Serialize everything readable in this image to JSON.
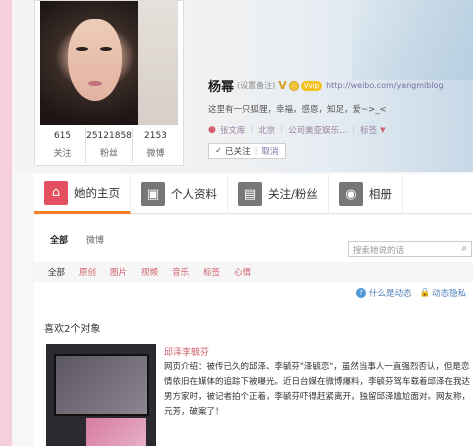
{
  "profile": {
    "stats": [
      {
        "num": "615",
        "label": "关注"
      },
      {
        "num": "25121858",
        "label": "粉丝"
      },
      {
        "num": "2153",
        "label": "微博"
      }
    ],
    "name": "杨幂",
    "note": "(设置备注)",
    "vip_badge": "V",
    "pill": "Vvip",
    "url": "http://weibo.com/yangmiblog",
    "intro": "这里有一只狐狸，幸福，感恩，知足，爱~>_<",
    "meta": {
      "gender_icon": "person-icon",
      "company": "张文库",
      "location": "北京",
      "org": "公司美亚娱乐...",
      "tag": "标签"
    },
    "follow": {
      "check": "✓",
      "followed": "已关注",
      "cancel": "取消"
    }
  },
  "tabs": [
    {
      "label": "她的主页",
      "icon": "house-icon",
      "glyph": "⌂"
    },
    {
      "label": "个人资料",
      "icon": "person-card-icon",
      "glyph": "👤"
    },
    {
      "label": "关注/粉丝",
      "icon": "people-icon",
      "glyph": "👥"
    },
    {
      "label": "相册",
      "icon": "camera-icon",
      "glyph": "📷"
    }
  ],
  "sub_nav": [
    "全部",
    "微博"
  ],
  "search": {
    "placeholder": "搜索她说的话",
    "icon": "search-icon"
  },
  "filters": [
    "全部",
    "原创",
    "图片",
    "视频",
    "音乐",
    "标签",
    "心情"
  ],
  "help": {
    "what_is": "什么是动态",
    "privacy": "动态隐私"
  },
  "liked": {
    "title": "喜欢2个对象",
    "post_title": "邱泽李毓芬",
    "post_text": "网页介绍：被传已久的邱泽、李毓芬\"泽毓恋\"，虽然当事人一直强烈否认，但是恋情依旧在媒体的追踪下被曝光。近日台媒在微博爆料，李毓芬驾车载着邱泽在我达男方家时，被记者拍个正着，李毓芬吓得赶紧离开，独留邱泽尴尬面对。网友称，元芳，破案了！"
  },
  "colors": {
    "accent": "#d0606e",
    "tab_active": "#f67e2a",
    "link": "#7a6fa0"
  }
}
